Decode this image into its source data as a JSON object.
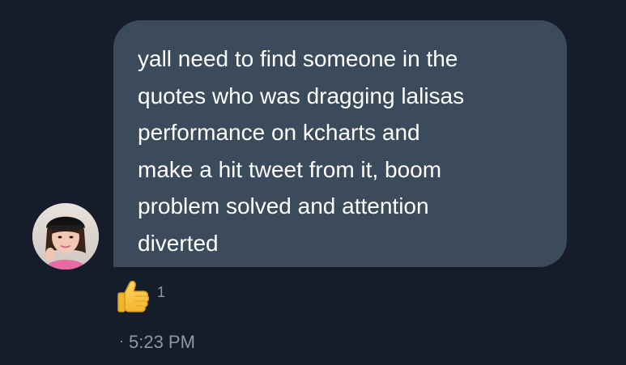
{
  "conversation": {
    "message": {
      "text": "yall need to find someone in the\nquotes who was dragging lalisas\nperformance on kcharts and\nmake a hit tweet from it, boom\nproblem solved and attention\ndiverted"
    },
    "reaction": {
      "icon": "thumbs-up-icon",
      "count": "1"
    },
    "timestamp": {
      "prefix": "·",
      "time": "5:23 PM"
    }
  },
  "colors": {
    "background": "#151d2a",
    "bubble": "#3b4b5b",
    "text": "#ffffff",
    "meta": "#8b98a5"
  }
}
